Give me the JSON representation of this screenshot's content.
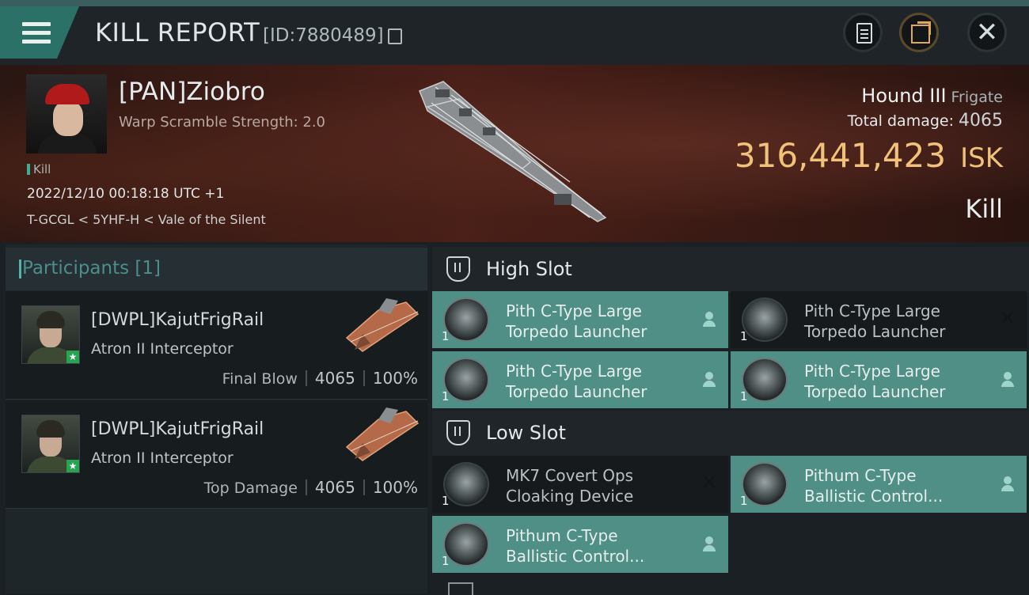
{
  "header": {
    "title": "KILL REPORT",
    "report_id": "[ID:7880489]"
  },
  "victim": {
    "name": "[PAN]Ziobro",
    "warp_scramble": "Warp Scramble Strength: 2.0",
    "tag": "Kill",
    "datetime": "2022/12/10 00:18:18 UTC +1",
    "location": "T-GCGL < 5YHF-H < Vale of the Silent",
    "ship_name": "Hound III",
    "ship_class": "Frigate",
    "total_damage_label": "Total damage:",
    "total_damage_value": "4065",
    "isk_value": "316,441,423",
    "isk_unit": "ISK",
    "result": "Kill"
  },
  "participants": {
    "label": "Participants",
    "count": "[1]",
    "rows": [
      {
        "name": "[DWPL]KajutFrigRail",
        "ship": "Atron II Interceptor",
        "role": "Final Blow",
        "damage": "4065",
        "percent": "100%"
      },
      {
        "name": "[DWPL]KajutFrigRail",
        "ship": "Atron II Interceptor",
        "role": "Top Damage",
        "damage": "4065",
        "percent": "100%"
      }
    ]
  },
  "slots": {
    "high_label": "High Slot",
    "low_label": "Low Slot",
    "modules": [
      {
        "line1": "Pith C-Type Large",
        "line2": "Torpedo Launcher",
        "qty": "1",
        "state": "dropped"
      },
      {
        "line1": "Pith C-Type Large",
        "line2": "Torpedo Launcher",
        "qty": "1",
        "state": "destroyed"
      },
      {
        "line1": "Pith C-Type Large",
        "line2": "Torpedo Launcher",
        "qty": "1",
        "state": "dropped"
      },
      {
        "line1": "Pith C-Type Large",
        "line2": "Torpedo Launcher",
        "qty": "1",
        "state": "dropped"
      },
      {
        "line1": "MK7 Covert Ops",
        "line2": "Cloaking Device",
        "qty": "1",
        "state": "destroyed"
      },
      {
        "line1": "Pithum C-Type",
        "line2": "Ballistic Control...",
        "qty": "1",
        "state": "dropped"
      },
      {
        "line1": "Pithum C-Type",
        "line2": "Ballistic Control...",
        "qty": "1",
        "state": "dropped"
      }
    ]
  },
  "icons": {
    "menu": "hamburger-icon",
    "copy": "copy-icon",
    "clipboard": "clipboard-icon",
    "share": "share-icon",
    "close": "close-icon",
    "slot": "slot-icon",
    "person": "person-icon",
    "destroyed": "x-icon"
  },
  "colors": {
    "accent_teal": "#4f8f86",
    "isk_gold": "#f0c27a",
    "menu_teal": "#2b7168"
  }
}
